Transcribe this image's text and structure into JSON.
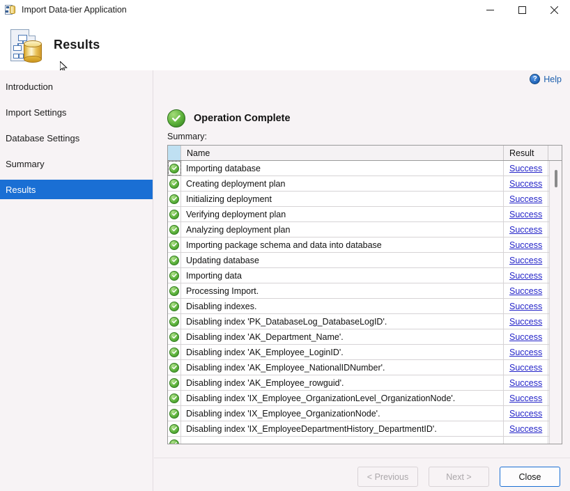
{
  "window": {
    "title": "Import Data-tier Application",
    "icon": "database-page-icon",
    "minimize_label": "Minimize",
    "maximize_label": "Maximize",
    "close_label": "Close"
  },
  "banner": {
    "title": "Results",
    "icon": "dacpac-database-icon"
  },
  "sidebar": {
    "items": [
      {
        "label": "Introduction",
        "active": false
      },
      {
        "label": "Import Settings",
        "active": false
      },
      {
        "label": "Database Settings",
        "active": false
      },
      {
        "label": "Summary",
        "active": false
      },
      {
        "label": "Results",
        "active": true
      }
    ],
    "active_color": "#1a6fd4"
  },
  "content": {
    "help_label": "Help",
    "help_icon": "help-circle-icon",
    "status_title": "Operation Complete",
    "status_icon": "green-check-icon",
    "status_color": "#5cb03a",
    "summary_label": "Summary:"
  },
  "table": {
    "columns": [
      "",
      "Name",
      "Result",
      ""
    ],
    "header_name": "Name",
    "header_result": "Result",
    "rows": [
      {
        "name": "Importing database",
        "result": "Success",
        "focused": true
      },
      {
        "name": "Creating deployment plan",
        "result": "Success",
        "focused": false
      },
      {
        "name": "Initializing deployment",
        "result": "Success",
        "focused": false
      },
      {
        "name": "Verifying deployment plan",
        "result": "Success",
        "focused": false
      },
      {
        "name": "Analyzing deployment plan",
        "result": "Success",
        "focused": false
      },
      {
        "name": "Importing package schema and data into database",
        "result": "Success",
        "focused": false
      },
      {
        "name": "Updating database",
        "result": "Success",
        "focused": false
      },
      {
        "name": "Importing data",
        "result": "Success",
        "focused": false
      },
      {
        "name": "Processing Import.",
        "result": "Success",
        "focused": false
      },
      {
        "name": "Disabling indexes.",
        "result": "Success",
        "focused": false
      },
      {
        "name": "Disabling index 'PK_DatabaseLog_DatabaseLogID'.",
        "result": "Success",
        "focused": false
      },
      {
        "name": "Disabling index 'AK_Department_Name'.",
        "result": "Success",
        "focused": false
      },
      {
        "name": "Disabling index 'AK_Employee_LoginID'.",
        "result": "Success",
        "focused": false
      },
      {
        "name": "Disabling index 'AK_Employee_NationalIDNumber'.",
        "result": "Success",
        "focused": false
      },
      {
        "name": "Disabling index 'AK_Employee_rowguid'.",
        "result": "Success",
        "focused": false
      },
      {
        "name": "Disabling index 'IX_Employee_OrganizationLevel_OrganizationNode'.",
        "result": "Success",
        "focused": false
      },
      {
        "name": "Disabling index 'IX_Employee_OrganizationNode'.",
        "result": "Success",
        "focused": false
      },
      {
        "name": "Disabling index 'IX_EmployeeDepartmentHistory_DepartmentID'.",
        "result": "Success",
        "focused": false
      },
      {
        "name": "",
        "result": "",
        "focused": false
      }
    ],
    "link_color": "#2323c8"
  },
  "footer": {
    "previous_label": "< Previous",
    "next_label": "Next >",
    "close_label": "Close",
    "previous_enabled": false,
    "next_enabled": false
  }
}
